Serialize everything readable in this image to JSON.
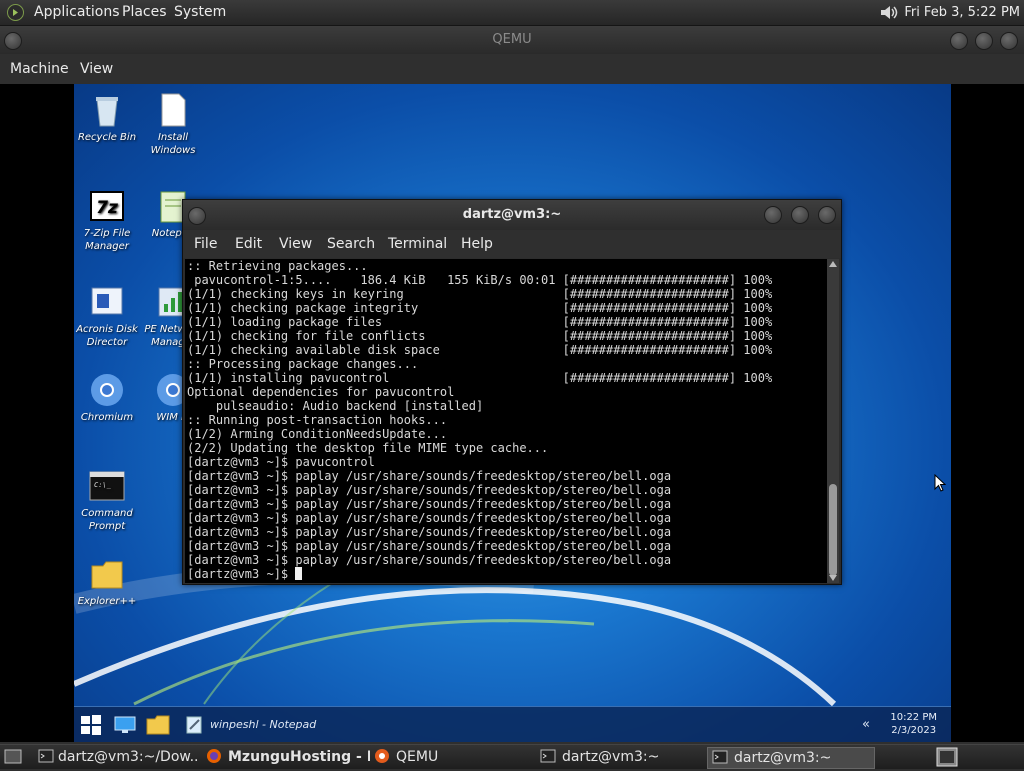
{
  "top_panel": {
    "menus": [
      "Applications",
      "Places",
      "System"
    ],
    "clock": "Fri Feb  3,  5:22 PM"
  },
  "qemu": {
    "title": "QEMU",
    "menus": [
      "Machine",
      "View"
    ]
  },
  "desktop_icons": [
    {
      "label": "Recycle Bin",
      "icon": "recycle-bin-icon"
    },
    {
      "label": "Install Windows",
      "icon": "document-icon"
    },
    {
      "label": "7-Zip File Manager",
      "icon": "7zip-icon"
    },
    {
      "label": "Notepad",
      "icon": "notepad-icon"
    },
    {
      "label": "Acronis Disk Director",
      "icon": "acronis-icon"
    },
    {
      "label": "PE Network Manager",
      "icon": "network-manager-icon"
    },
    {
      "label": "Chromium",
      "icon": "chromium-icon"
    },
    {
      "label": "WIM Fi",
      "icon": "chromium-icon"
    },
    {
      "label": "Command Prompt",
      "icon": "command-prompt-icon"
    },
    {
      "label": "Explorer++",
      "icon": "folder-icon"
    }
  ],
  "terminal": {
    "title": "dartz@vm3:~",
    "menus": [
      "File",
      "Edit",
      "View",
      "Search",
      "Terminal",
      "Help"
    ],
    "lines": [
      ":: Retrieving packages...",
      " pavucontrol-1:5....    186.4 KiB   155 KiB/s 00:01 [######################] 100%",
      "(1/1) checking keys in keyring                      [######################] 100%",
      "(1/1) checking package integrity                    [######################] 100%",
      "(1/1) loading package files                         [######################] 100%",
      "(1/1) checking for file conflicts                   [######################] 100%",
      "(1/1) checking available disk space                 [######################] 100%",
      ":: Processing package changes...",
      "(1/1) installing pavucontrol                        [######################] 100%",
      "Optional dependencies for pavucontrol",
      "    pulseaudio: Audio backend [installed]",
      ":: Running post-transaction hooks...",
      "(1/2) Arming ConditionNeedsUpdate...",
      "(2/2) Updating the desktop file MIME type cache...",
      "[dartz@vm3 ~]$ pavucontrol",
      "[dartz@vm3 ~]$ paplay /usr/share/sounds/freedesktop/stereo/bell.oga",
      "[dartz@vm3 ~]$ paplay /usr/share/sounds/freedesktop/stereo/bell.oga",
      "[dartz@vm3 ~]$ paplay /usr/share/sounds/freedesktop/stereo/bell.oga",
      "[dartz@vm3 ~]$ paplay /usr/share/sounds/freedesktop/stereo/bell.oga",
      "[dartz@vm3 ~]$ paplay /usr/share/sounds/freedesktop/stereo/bell.oga",
      "[dartz@vm3 ~]$ paplay /usr/share/sounds/freedesktop/stereo/bell.oga",
      "[dartz@vm3 ~]$ paplay /usr/share/sounds/freedesktop/stereo/bell.oga"
    ],
    "prompt": "[dartz@vm3 ~]$ "
  },
  "win_taskbar": {
    "notepad_task": "winpeshl - Notepad",
    "time": "10:22 PM",
    "date": "2/3/2023"
  },
  "bottom_panel": {
    "tasks": [
      {
        "label": "dartz@vm3:~/Dow...",
        "icon": "terminal-icon"
      },
      {
        "label": "MzunguHosting - B...",
        "icon": "firefox-icon"
      },
      {
        "label": "QEMU",
        "icon": "qemu-icon"
      },
      {
        "label": "dartz@vm3:~",
        "icon": "terminal-icon"
      },
      {
        "label": "dartz@vm3:~",
        "icon": "terminal-icon"
      }
    ]
  }
}
